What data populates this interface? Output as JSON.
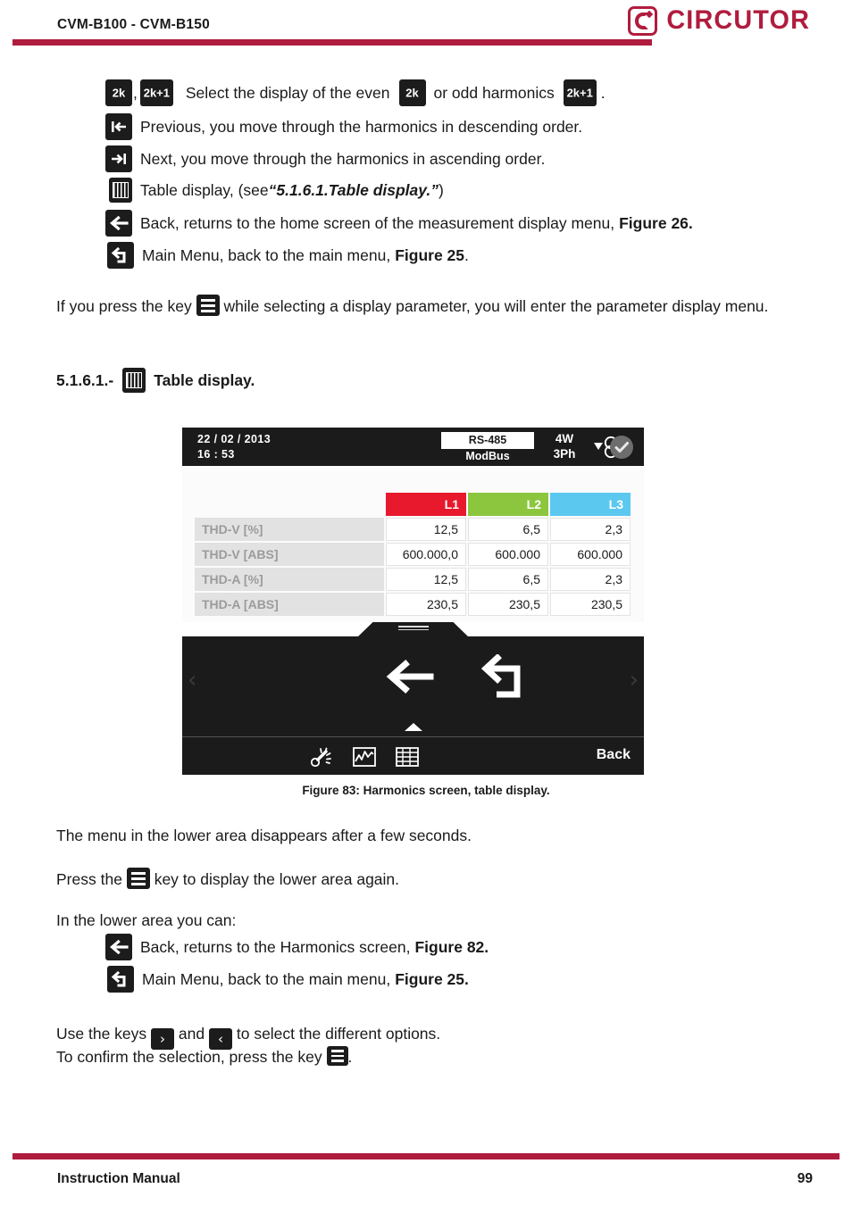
{
  "header": {
    "title": "CVM-B100 - CVM-B150",
    "brand": "CIRCUTOR",
    "rule_color": "#b01c3e"
  },
  "body": {
    "line_even_odd": {
      "key1": "2k",
      "key2": "2k+1",
      "text_a": "Select the display of the even",
      "key3": "2k",
      "text_b": "or odd harmonics",
      "key4": "2k+1",
      "text_c": "."
    },
    "items": [
      {
        "icon": "previous-icon",
        "text": "Previous, you move through the harmonics in descending order."
      },
      {
        "icon": "next-icon",
        "text": "Next, you move through the harmonics in ascending order."
      },
      {
        "icon": "table-icon",
        "text": "Table display, (see ",
        "emphasis": "“5.1.6.1.Table display.”",
        "text_end": ")"
      },
      {
        "icon": "back-arrow-icon",
        "text": "Back, returns to the home screen of the measurement display menu,",
        "bold": "Figure 26."
      },
      {
        "icon": "main-menu-icon",
        "text": "Main Menu, back to the main menu,",
        "bold": "Figure 25",
        "text_end": "."
      }
    ],
    "para_press_key": {
      "before": "If you press the key",
      "after": "while selecting a display parameter, you will enter the parameter display menu."
    },
    "section_heading": {
      "number": "5.1.6.1.-",
      "title": "Table display."
    },
    "para_menu_disappears": "The menu in the lower area disappears after a few seconds.",
    "para_press_again": {
      "before": "Press the",
      "after": "key to display the lower area again."
    },
    "para_lower_area": "In the lower area you can:",
    "items_lower": [
      {
        "icon": "back-arrow-icon",
        "text": "Back, returns to the Harmonics screen,",
        "bold": "Figure 82."
      },
      {
        "icon": "main-menu-icon",
        "text": "Main Menu, back to the main menu,",
        "bold": "Figure 25."
      }
    ],
    "para_use_keys": {
      "before": "Use the keys",
      "key_right": "›",
      "middle": "and",
      "key_left": "‹",
      "after": "to select the different options."
    },
    "para_confirm": {
      "before": "To confirm the selection, press the key",
      "after": "."
    }
  },
  "device": {
    "status": {
      "date": "22 / 02 / 2013",
      "time": "16 : 53",
      "comm_protocol_boxed": "RS-485",
      "comm_protocol": "ModBus",
      "wiring_line1": "4W",
      "wiring_line2": "3Ph",
      "phasor_icon": "phasor-diagram-icon",
      "status_icon": "check-circle-icon"
    },
    "table": {
      "columns": [
        {
          "label": "L1",
          "color": "#e8192c"
        },
        {
          "label": "L2",
          "color": "#8cc63f"
        },
        {
          "label": "L3",
          "color": "#5bc8f0"
        }
      ],
      "rows": [
        {
          "label": "THD-V [%]",
          "values": [
            "12,5",
            "6,5",
            "2,3"
          ]
        },
        {
          "label": "THD-V [ABS]",
          "values": [
            "600.000,0",
            "600.000",
            "600.000"
          ]
        },
        {
          "label": "THD-A [%]",
          "values": [
            "12,5",
            "6,5",
            "2,3"
          ]
        },
        {
          "label": "THD-A [ABS]",
          "values": [
            "230,5",
            "230,5",
            "230,5"
          ]
        }
      ]
    },
    "menu": {
      "left_chevron": "‹",
      "right_chevron": "›",
      "back_arrow_icon": "back-arrow-icon",
      "return_arrow_icon": "main-menu-return-icon",
      "caret_icon": "caret-up-icon",
      "toolbar_icons": [
        "flicker-icon",
        "graph-icon",
        "table-icon"
      ],
      "back_label": "Back"
    }
  },
  "figure_caption": "Figure 83: Harmonics screen, table display.",
  "footer": {
    "left": "Instruction Manual",
    "page": "99"
  }
}
